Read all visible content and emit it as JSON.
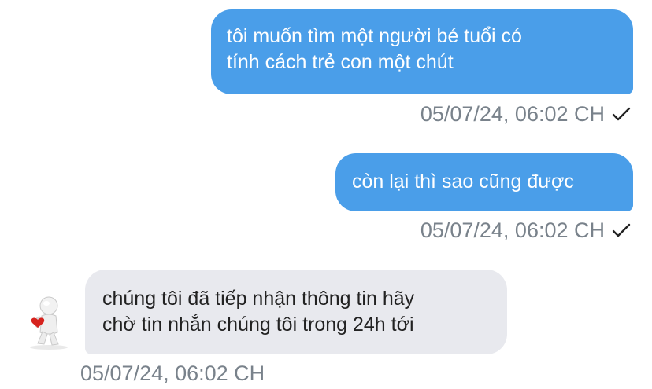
{
  "messages": [
    {
      "direction": "outgoing",
      "text": "tôi muốn tìm một người bé tuổi có\ntính cách trẻ con một chút",
      "timestamp": "05/07/24, 06:02 CH",
      "status_icon": "checkmark-icon"
    },
    {
      "direction": "outgoing",
      "text": "còn lại thì sao cũng được",
      "timestamp": "05/07/24, 06:02 CH",
      "status_icon": "checkmark-icon"
    },
    {
      "direction": "incoming",
      "text": "chúng tôi đã tiếp nhận thông tin hãy\nchờ tin nhắn chúng tôi trong 24h tới",
      "timestamp": "05/07/24, 06:02 CH",
      "avatar_icon": "white-figure-with-red-heart-icon"
    }
  ],
  "colors": {
    "outgoing_bubble": "#4a9ee9",
    "incoming_bubble": "#e8e9ee",
    "timestamp_text": "#79828b"
  }
}
